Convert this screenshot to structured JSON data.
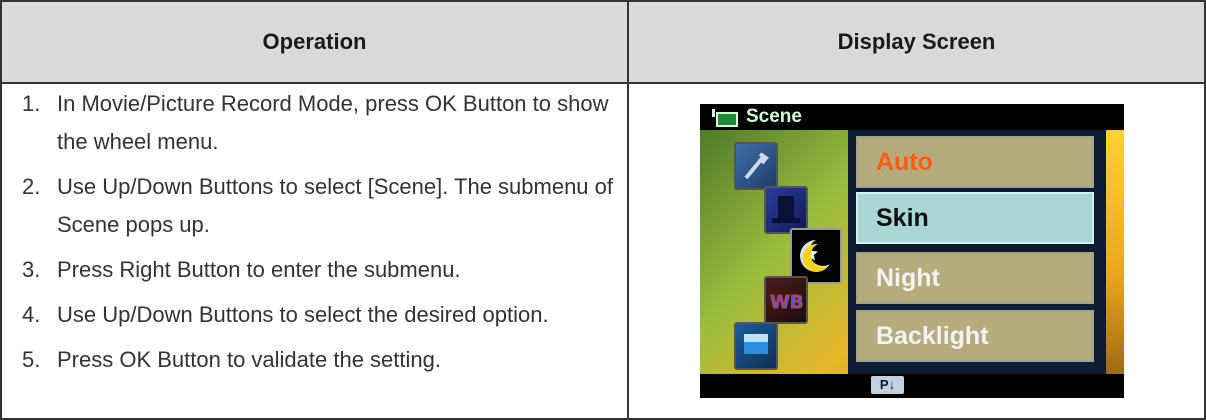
{
  "table": {
    "headers": [
      "Operation",
      "Display Screen"
    ],
    "steps": [
      {
        "num": "1.",
        "text": "In Movie/Picture Record Mode, press OK Button to show the wheel menu."
      },
      {
        "num": "2.",
        "text": "Use Up/Down Buttons to select [Scene]. The submenu of Scene pops up."
      },
      {
        "num": "3.",
        "text": "Press Right Button to enter the submenu."
      },
      {
        "num": "4.",
        "text": "Use Up/Down Buttons to select the desired option."
      },
      {
        "num": "5.",
        "text": "Press OK Button to validate the setting."
      }
    ]
  },
  "display": {
    "title": "Scene",
    "options": [
      "Auto",
      "Skin",
      "Night",
      "Backlight"
    ],
    "selected": "Skin",
    "page_indicator": "P↓",
    "colors": {
      "title": "#d4ffd4",
      "auto": "#ff5d10",
      "selected_bg": "#a9d7d6",
      "panel": "#0e1c33"
    }
  }
}
